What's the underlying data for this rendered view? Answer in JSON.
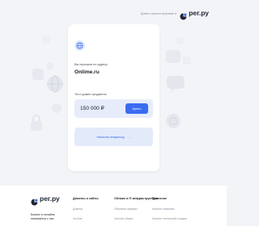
{
  "header": {
    "domain_by": "Домен зарегистрирован в",
    "logo_text": "рег.ру"
  },
  "card": {
    "redirect_text": "Вы перешли по адресу",
    "domain": "Onlime.ru",
    "for_sale": "Этот домен продается",
    "price": "150 000 ₽",
    "buy_label": "Купить",
    "owner_label": "Написать владельцу",
    "owner_arrow": "→"
  },
  "footer": {
    "logo_text": "рег.ру",
    "tagline_line1": "Бизнес в онлайне",
    "tagline_line2": "начинается с нас",
    "columns": [
      {
        "title": "Домены и сайты",
        "items": [
          "Домены",
          "Хостинг"
        ]
      },
      {
        "title": "Облако и IT-инфраструктура",
        "items": [
          "Облачные серверы",
          "Частное облако"
        ]
      },
      {
        "title": "Полезное",
        "items": [
          "Новости компании",
          "Новости технологий и медиа"
        ]
      }
    ]
  },
  "colors": {
    "accent": "#3b6cf0",
    "background": "#f2f4f7",
    "price_box": "#e6ecfa"
  }
}
